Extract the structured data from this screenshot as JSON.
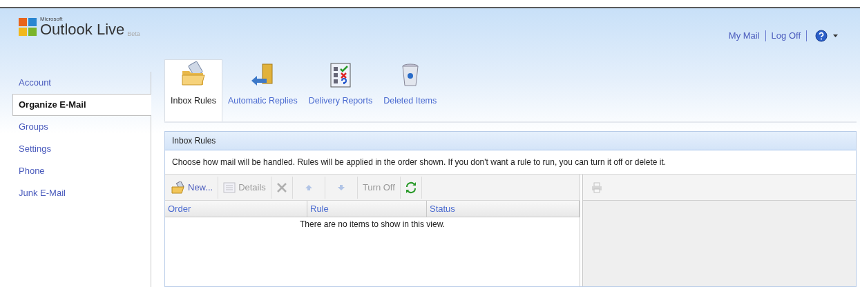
{
  "header": {
    "logo": {
      "company": "Microsoft",
      "product": "Outlook Live",
      "tag": "Beta"
    },
    "links": [
      "My Mail",
      "Log Off"
    ]
  },
  "sidebar": {
    "items": [
      {
        "label": "Account",
        "selected": false
      },
      {
        "label": "Organize E-Mail",
        "selected": true
      },
      {
        "label": "Groups",
        "selected": false
      },
      {
        "label": "Settings",
        "selected": false
      },
      {
        "label": "Phone",
        "selected": false
      },
      {
        "label": "Junk E-Mail",
        "selected": false
      }
    ]
  },
  "tabs": [
    {
      "kind": "rules",
      "label": "Inbox Rules",
      "selected": true
    },
    {
      "kind": "replies",
      "label": "Automatic Replies",
      "selected": false
    },
    {
      "kind": "reports",
      "label": "Delivery Reports",
      "selected": false
    },
    {
      "kind": "deleted",
      "label": "Deleted Items",
      "selected": false
    }
  ],
  "panel": {
    "title": "Inbox Rules",
    "description": "Choose how mail will be handled. Rules will be applied in the order shown. If you don't want a rule to run, you can turn it off or delete it.",
    "toolbar": [
      {
        "kind": "new",
        "label": "New...",
        "disabled": false
      },
      {
        "kind": "details",
        "label": "Details",
        "disabled": true
      },
      {
        "kind": "delete",
        "disabled": true
      },
      {
        "kind": "up",
        "disabled": true
      },
      {
        "kind": "down",
        "disabled": true
      },
      {
        "kind": "text",
        "label": "Turn Off",
        "disabled": true
      },
      {
        "kind": "refresh",
        "disabled": false
      }
    ],
    "columns": [
      "Order",
      "Rule",
      "Status"
    ],
    "empty_message": "There are no items to show in this view.",
    "detail_toolbar": {
      "print_disabled": true
    }
  }
}
